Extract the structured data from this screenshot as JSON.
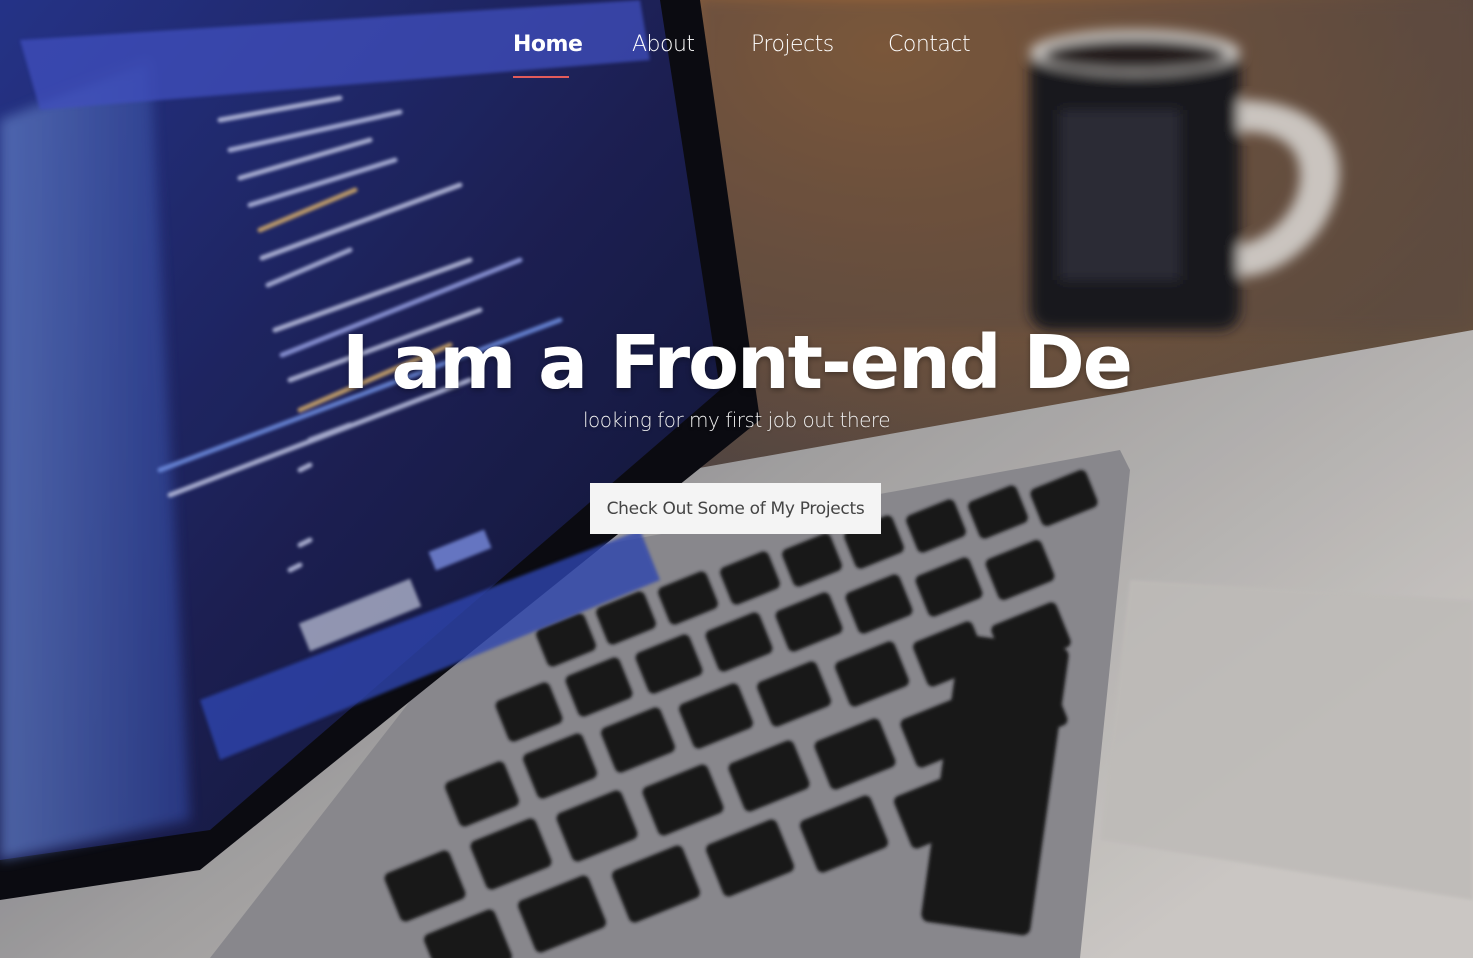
{
  "nav": {
    "items": [
      {
        "label": "Home",
        "active": true
      },
      {
        "label": "About",
        "active": false
      },
      {
        "label": "Projects",
        "active": false
      },
      {
        "label": "Contact",
        "active": false
      }
    ],
    "active_underline_color": "#e25b5b"
  },
  "hero": {
    "headline": "I am a Front-end De",
    "subline": "looking for my first job out there",
    "cta_label": "Check Out Some of My Projects",
    "background_image": "laptop-with-code-and-mug-photo"
  }
}
